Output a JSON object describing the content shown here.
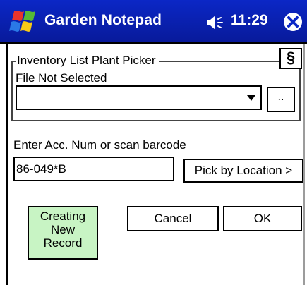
{
  "title_bar": {
    "app_title": "Garden Notepad",
    "time": "11:29",
    "start_icon": "windows-flag-icon",
    "volume_icon": "speaker-icon",
    "close_icon": "close-icon",
    "bar_color": "#0b27c6"
  },
  "plant_picker": {
    "group_title": "Inventory List Plant Picker",
    "section_label": "§",
    "file_status": "File Not Selected",
    "dropdown_value": "",
    "browse_label": ".."
  },
  "accession": {
    "label": "Enter Acc. Num or scan barcode",
    "value": "86-049*B",
    "pick_location_label": "Pick by Location >"
  },
  "actions": {
    "status_line1": "Creating",
    "status_line2": "New",
    "status_line3": "Record",
    "status_color": "#c8f4c4",
    "cancel_label": "Cancel",
    "ok_label": "OK"
  }
}
